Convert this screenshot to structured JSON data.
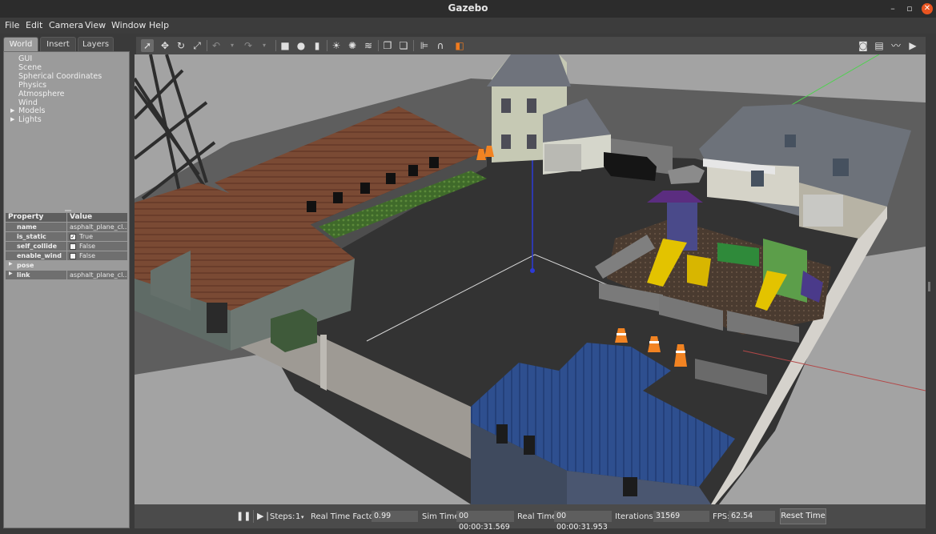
{
  "window": {
    "title": "Gazebo"
  },
  "menu": [
    "File",
    "Edit",
    "Camera",
    "View",
    "Window",
    "Help"
  ],
  "left_panel": {
    "tabs": [
      "World",
      "Insert",
      "Layers"
    ],
    "active_tab": "World",
    "tree": [
      "GUI",
      "Scene",
      "Spherical Coordinates",
      "Physics",
      "Atmosphere",
      "Wind",
      "Models",
      "Lights"
    ],
    "property_table": {
      "headers": [
        "Property",
        "Value"
      ],
      "rows": [
        {
          "name": "name",
          "value": "asphalt_plane_cl..."
        },
        {
          "name": "is_static",
          "value": "True",
          "checked": true
        },
        {
          "name": "self_collide",
          "value": "False",
          "checked": false
        },
        {
          "name": "enable_wind",
          "value": "False",
          "checked": false
        },
        {
          "name": "pose",
          "value": ""
        },
        {
          "name": "link",
          "value": "asphalt_plane_cl..."
        }
      ]
    }
  },
  "toolbar": {
    "left_tools": [
      "select-mode",
      "translate-mode",
      "rotate-mode",
      "scale-mode",
      "undo",
      "undo-history",
      "redo",
      "redo-history",
      "box-shape",
      "sphere-shape",
      "cylinder-shape",
      "point-light",
      "spot-light",
      "directional-light",
      "copy",
      "paste",
      "align",
      "snap",
      "change-view"
    ],
    "right_tools": [
      "screenshot",
      "log",
      "plot",
      "video-record"
    ]
  },
  "status": {
    "steps_label": "Steps:",
    "steps_value": "1",
    "rtf_label": "Real Time Factor:",
    "rtf_value": "0.99",
    "sim_time_label": "Sim Time:",
    "sim_time_value": "00 00:00:31.569",
    "real_time_label": "Real Time:",
    "real_time_value": "00 00:00:31.953",
    "iterations_label": "Iterations:",
    "iterations_value": "31569",
    "fps_label": "FPS:",
    "fps_value": "62.54",
    "reset_label": "Reset Time"
  },
  "colors": {
    "accent": "#e95420",
    "panel": "#9b9b9b",
    "viewport_ground": "#3a3a3a"
  }
}
